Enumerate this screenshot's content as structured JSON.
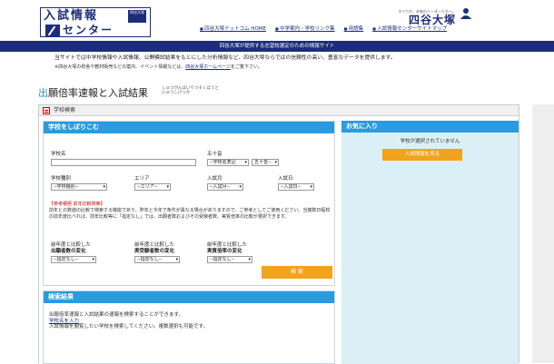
{
  "header": {
    "logo_line1": "入試情報",
    "logo_badge": "四谷大塚",
    "logo_line2": "センター",
    "nav": [
      "四谷大塚ドットコム HOME",
      "中学案内・学校リンク集",
      "用語集",
      "入試情報センターサイトマップ"
    ],
    "brand_sub": "すべての、未来のリーダーたちへ。",
    "brand_name": "四谷大塚"
  },
  "tagline": "四谷大塚が提供する志望校選定のための情報サイト",
  "intro": {
    "main": "当サイトでは中学校情報や入試情報、公開模試結果をもとにした分析情報など、四谷大塚ならではの信頼性の高い、豊富なデータを提供します。",
    "small_prefix": "※四谷大塚の校舎や教材販売などの案内、イベント情報などは、",
    "small_link": "四谷大塚ホームページ",
    "small_suffix": "をご覧下さい。"
  },
  "page": {
    "title_accent": "出",
    "title_rest": "願倍率速報と入試結果",
    "title_ruby_1": "しゅつがんばいりつそくほうと",
    "title_ruby_2": "にゅうしけっか"
  },
  "search_section": {
    "label": "学校検索",
    "panel_title": "学校をしぼりこむ",
    "school_name_label": "学校名",
    "gojuon_label": "五十音",
    "gojuon_select": "--学校名表記",
    "gojuon_select2": "五十音--",
    "school_type_label": "学校種別",
    "school_type_select": "--学校種別--",
    "area_label": "エリア",
    "area_select": "--エリア--",
    "entry_month_label": "入試月",
    "entry_month_select": "--入試月--",
    "entry_day_label": "入試日",
    "entry_day_select": "--入試日--",
    "note_red": "【参考積極 前年比較検索】",
    "note_body": "前年との数値の比較で検索する機能であり、昨年と今年で条件が異なる場合がありますので、ご参考としてご使用ください。当複数日程校の前年度比べれば、前年比較等に「指定なし」では、出願者数およびその受験者数、実質倍率の比較が選択できます。",
    "cmp1_label_1": "前年度と比較した",
    "cmp1_label_2": "出願者数の変化",
    "cmp1_select": "--指定なし--",
    "cmp2_label_1": "前年度と比較した",
    "cmp2_label_2": "実受験者数の変化",
    "cmp2_select": "--指定なし--",
    "cmp3_label_1": "前年度と比較した",
    "cmp3_label_2": "実質倍率の変化",
    "cmp3_select": "--指定なし--",
    "search_button": "検 索"
  },
  "results": {
    "title": "検索結果",
    "line1": "出願倍率速報と入試結果の速報を検索することができます。",
    "link": "学校名を入力",
    "line3": "入試情報を閲覧したい学校を検索してください。複数選択も可能です。"
  },
  "favorites": {
    "title": "お気に入り",
    "empty_text": "学校が選択されていません",
    "button": "入試情報を見る"
  },
  "colors": {
    "navy": "#1c2d7a",
    "accent_blue": "#2a9be0",
    "orange": "#f3a21d",
    "fav_bg": "#dbf0f6"
  }
}
